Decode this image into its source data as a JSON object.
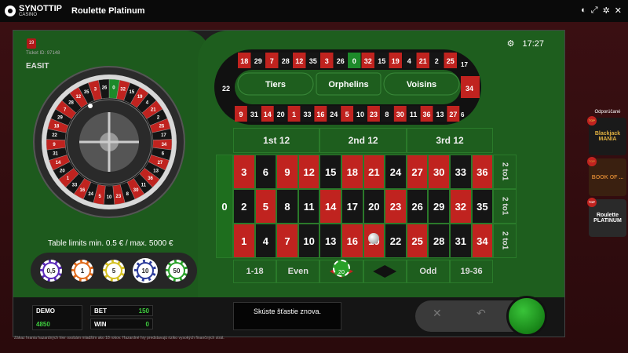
{
  "app": {
    "brand": "SYNOTTIP",
    "brand_sub": "CASINO",
    "title": "Roulette Platinum",
    "time": "17:27"
  },
  "ticket": "Ticket ID: 97148",
  "icon_badge": "19",
  "provider": "EASIT",
  "limits": "Table limits min. 0.5 € / max. 5000 €",
  "chips": [
    "0,5",
    "1",
    "5",
    "10",
    "50"
  ],
  "racetrack": {
    "top": [
      "18",
      "29",
      "7",
      "28",
      "12",
      "35",
      "3",
      "26",
      "0",
      "32",
      "15",
      "19",
      "4",
      "21",
      "2",
      "25"
    ],
    "bottom": [
      "9",
      "31",
      "14",
      "20",
      "1",
      "33",
      "16",
      "24",
      "5",
      "10",
      "23",
      "8",
      "30",
      "11",
      "36",
      "13",
      "27"
    ],
    "left": "22",
    "right": "34",
    "right2": "17",
    "right3": "6",
    "sections": [
      "Tiers",
      "Orphelins",
      "Voisins"
    ]
  },
  "table": {
    "dozens": [
      "1st  12",
      "2nd  12",
      "3rd  12"
    ],
    "zero": "0",
    "rows": [
      [
        "3",
        "6",
        "9",
        "12",
        "15",
        "18",
        "21",
        "24",
        "27",
        "30",
        "33",
        "36"
      ],
      [
        "2",
        "5",
        "8",
        "11",
        "14",
        "17",
        "20",
        "23",
        "26",
        "29",
        "32",
        "35"
      ],
      [
        "1",
        "4",
        "7",
        "10",
        "13",
        "16",
        "19",
        "22",
        "25",
        "28",
        "31",
        "34"
      ]
    ],
    "column_bets": [
      "2 to1",
      "2 to1",
      "2 to1"
    ],
    "outside": [
      "1-18",
      "Even",
      "",
      "",
      "Odd",
      "19-36"
    ],
    "chip_on_table": "20"
  },
  "stats": {
    "demo_label": "DEMO",
    "demo_value": "4850",
    "bet_label": "BET",
    "bet_value": "150",
    "win_label": "WIN",
    "win_value": "0"
  },
  "message": "Skúste šťastie znova.",
  "legal": "Zákaz hrania hazardných hier osobám mladším ako 18 rokov. Hazardné hry predstavujú riziko vysokých finančných strát.",
  "sidebar": {
    "title": "Odporúčané",
    "items": [
      "Blackjack MANIA",
      "BOOK OF ...",
      "Roulette PLATINUM"
    ],
    "badge": "TOP"
  }
}
